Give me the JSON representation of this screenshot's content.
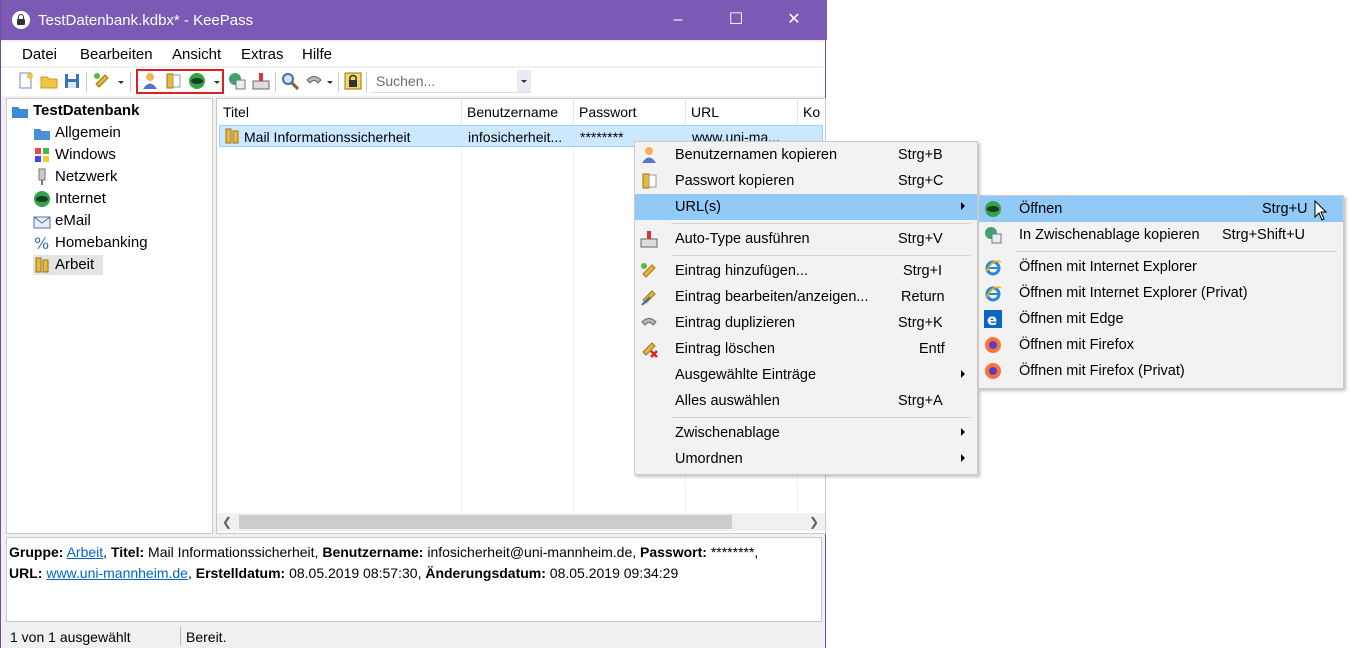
{
  "window": {
    "title": "TestDatenbank.kdbx* - KeePass",
    "controls": {
      "minimize": "–",
      "maximize": "☐",
      "close": "✕"
    }
  },
  "menubar": [
    "Datei",
    "Bearbeiten",
    "Ansicht",
    "Extras",
    "Hilfe"
  ],
  "toolbar": {
    "search_placeholder": "Suchen..."
  },
  "tree": {
    "root": "TestDatenbank",
    "groups": [
      "Allgemein",
      "Windows",
      "Netzwerk",
      "Internet",
      "eMail",
      "Homebanking",
      "Arbeit"
    ],
    "selected": "Arbeit"
  },
  "list": {
    "columns": [
      "Titel",
      "Benutzername",
      "Passwort",
      "URL",
      "Ko"
    ],
    "rows": [
      {
        "title": "Mail Informationssicherheit",
        "user": "infosicherheit...",
        "password": "********",
        "url": "www.uni-ma..."
      }
    ]
  },
  "details": {
    "group_label": "Gruppe:",
    "group": "Arbeit",
    "title_label": "Titel:",
    "title": "Mail Informationssicherheit",
    "user_label": "Benutzername:",
    "user": "infosicherheit@uni-mannheim.de",
    "password_label": "Passwort:",
    "password": "********",
    "url_label": "URL:",
    "url": "www.uni-mannheim.de",
    "created_label": "Erstelldatum:",
    "created": "08.05.2019 08:57:30",
    "modified_label": "Änderungsdatum:",
    "modified": "08.05.2019 09:34:29"
  },
  "status": {
    "selection": "1 von 1 ausgewählt",
    "state": "Bereit."
  },
  "context_menu": {
    "items": [
      {
        "label": "Benutzernamen kopieren",
        "shortcut": "Strg+B",
        "icon": "user-icon"
      },
      {
        "label": "Passwort kopieren",
        "shortcut": "Strg+C",
        "icon": "key-icon"
      },
      {
        "label": "URL(s)",
        "shortcut": "",
        "icon": "",
        "submenu": true
      },
      {
        "label": "Auto-Type ausführen",
        "shortcut": "Strg+V",
        "icon": "keyboard-icon"
      },
      {
        "label": "Eintrag hinzufügen...",
        "shortcut": "Strg+I",
        "icon": "add-key-icon"
      },
      {
        "label": "Eintrag bearbeiten/anzeigen...",
        "shortcut": "Return",
        "icon": "edit-key-icon"
      },
      {
        "label": "Eintrag duplizieren",
        "shortcut": "Strg+K",
        "icon": "duplicate-key-icon"
      },
      {
        "label": "Eintrag löschen",
        "shortcut": "Entf",
        "icon": "delete-key-icon"
      },
      {
        "label": "Ausgewählte Einträge",
        "shortcut": "",
        "icon": "",
        "submenu": true
      },
      {
        "label": "Alles auswählen",
        "shortcut": "Strg+A",
        "icon": ""
      },
      {
        "label": "Zwischenablage",
        "shortcut": "",
        "icon": "",
        "submenu": true
      },
      {
        "label": "Umordnen",
        "shortcut": "",
        "icon": "",
        "submenu": true
      }
    ]
  },
  "url_submenu": {
    "items": [
      {
        "label": "Öffnen",
        "shortcut": "Strg+U",
        "icon": "globe-icon"
      },
      {
        "label": "In Zwischenablage kopieren",
        "shortcut": "Strg+Shift+U",
        "icon": "copy-url-icon"
      },
      {
        "label": "Öffnen mit Internet Explorer",
        "shortcut": "",
        "icon": "internet-explorer-icon"
      },
      {
        "label": "Öffnen mit Internet Explorer (Privat)",
        "shortcut": "",
        "icon": "internet-explorer-icon"
      },
      {
        "label": "Öffnen mit Edge",
        "shortcut": "",
        "icon": "edge-icon"
      },
      {
        "label": "Öffnen mit Firefox",
        "shortcut": "",
        "icon": "firefox-icon"
      },
      {
        "label": "Öffnen mit Firefox (Privat)",
        "shortcut": "",
        "icon": "firefox-icon"
      }
    ]
  },
  "colors": {
    "titlebar": "#7b5ab5",
    "selection": "#cce8ff",
    "menu_highlight": "#91c9f7",
    "annotation": "#e02020"
  }
}
